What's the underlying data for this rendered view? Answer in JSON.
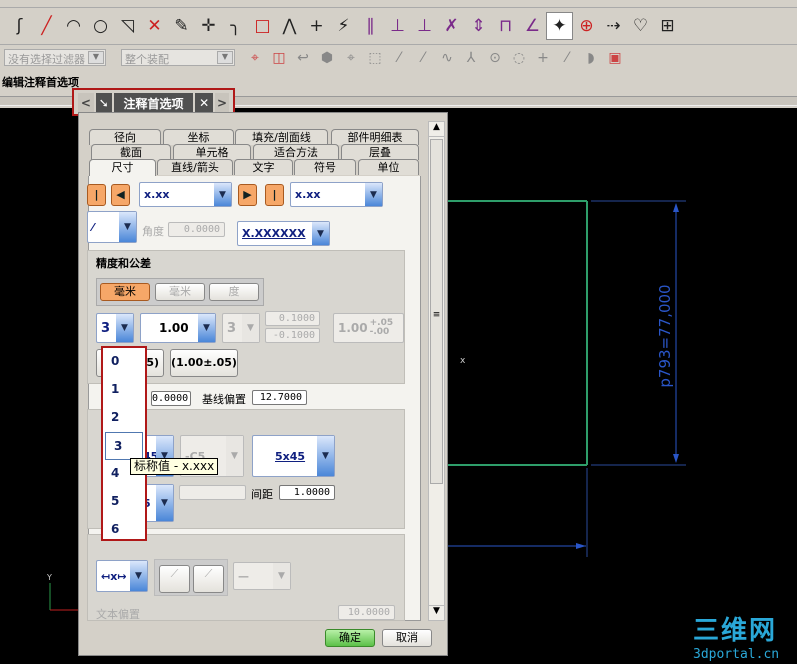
{
  "toolbar": {
    "row1_icons": [
      "studio-spline-icon",
      "line-icon",
      "arc-icon",
      "circle-icon",
      "fillet-corner-icon",
      "trim-icon",
      "trim-edit-icon",
      "intersect-icon",
      "corner-fillet-icon",
      "rectangle-icon",
      "polygon-icon",
      "point-icon",
      "quick-dimension-icon",
      "parallel-constraint-icon",
      "sketch-tool-icon",
      "perpendicular-icon",
      "delete-constraint-icon",
      "length-icon",
      "offset-icon",
      "angle-icon",
      "auto-dimension-icon",
      "add-object-icon",
      "drag-icon",
      "profile-icon",
      "pattern-icon"
    ],
    "filter_combo": "没有选择过滤器",
    "scope_combo": "整个装配",
    "row2_icons": [
      "selection-filter-icon",
      "snap-icon",
      "undo-icon",
      "shade-icon",
      "point-snap-icon",
      "box-select-icon",
      "end-point-icon",
      "mid-point-icon",
      "control-point-icon",
      "intersection-icon",
      "center-icon",
      "quadrant-icon",
      "existing-point-icon",
      "point-on-curve-icon",
      "surface-icon",
      "part-icon"
    ]
  },
  "status_text": "编辑注释首选项",
  "dialog_tab": {
    "title": "注释首选项"
  },
  "dialog": {
    "tabs_row1": [
      "径向",
      "坐标",
      "填充/剖面线",
      "部件明细表"
    ],
    "tabs_row2": [
      "截面",
      "单元格",
      "适合方法",
      "层叠"
    ],
    "tabs_row3": [
      "尺寸",
      "直线/箭头",
      "文字",
      "符号",
      "单位"
    ],
    "selected_tab": "尺寸",
    "dim_style_left": "x.xx",
    "dim_style_right": "x.xx",
    "angle_label": "角度",
    "angle_value": "0.0000",
    "text_placement": "X.XXXXXX",
    "precision": {
      "title": "精度和公差",
      "unit_buttons": [
        "毫米",
        "毫米",
        "度"
      ],
      "precision_value": "3",
      "tolerance_type": "1.00",
      "tol_precision": "3",
      "upper_tol": "0.1000",
      "lower_tol": "-0.1000",
      "tol_display": "1.00",
      "tol_plus": "+.05",
      "tol_minus": "-.00",
      "btn_a": ".05)",
      "btn_b": "(1.00±.05)"
    },
    "chain_offset": "0.0000",
    "baseline_label": "基线偏置",
    "baseline_offset": "12.7000",
    "chamfer": {
      "combo1": "45",
      "combo2": "-C5",
      "combo3": "5x45",
      "combo4": "5",
      "spacing_label": "间距",
      "spacing": "1.0000"
    },
    "text_section": {
      "label": "文本偏置",
      "value": "10.0000"
    },
    "ok": "确定",
    "cancel": "取消"
  },
  "dropdown": {
    "options": [
      "0",
      "1",
      "2",
      "3",
      "4",
      "5",
      "6"
    ],
    "highlighted": "3"
  },
  "tooltip": "标称值 - x.xxx",
  "canvas": {
    "dimension_text": "p793=77,000",
    "axis_y": "Y",
    "axis_x": "X",
    "x_marker": "x"
  },
  "watermark": {
    "title": "三维网",
    "url": "3dportal.cn"
  },
  "colors": {
    "geometry": "#2e9e6a",
    "dimension": "#2a56c8",
    "highlight": "#b01818",
    "ok": "#70d060"
  }
}
